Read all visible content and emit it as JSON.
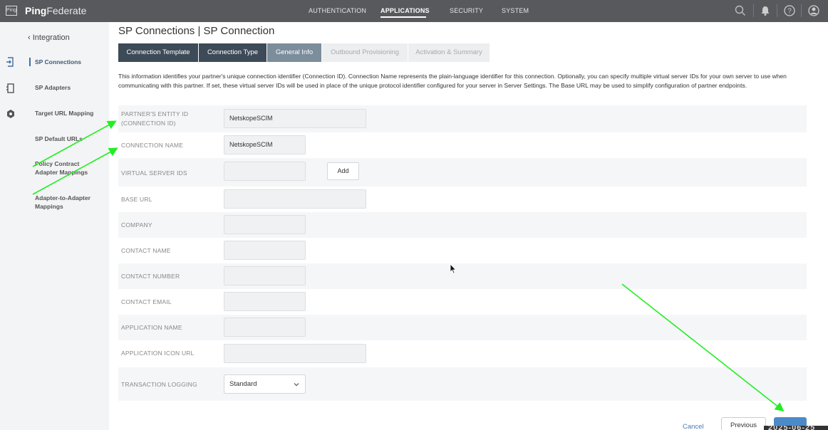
{
  "header": {
    "logo_text": "Ping",
    "brand_bold": "Ping",
    "brand_rest": "Federate",
    "nav": [
      "AUTHENTICATION",
      "APPLICATIONS",
      "SECURITY",
      "SYSTEM"
    ],
    "active_nav": "APPLICATIONS",
    "icons": [
      "search-icon",
      "bell-icon",
      "help-icon",
      "user-icon"
    ]
  },
  "rail": {
    "icons": [
      "connections-icon",
      "adapters-icon",
      "mapping-icon"
    ]
  },
  "sidebar": {
    "back_label": "Integration",
    "items": [
      {
        "label": "SP Connections",
        "active": true
      },
      {
        "label": "SP Adapters"
      },
      {
        "label": "Target URL Mapping"
      },
      {
        "label": "SP Default URLs"
      },
      {
        "label": "Policy Contract Adapter Mappings"
      },
      {
        "label": "Adapter-to-Adapter Mappings"
      }
    ]
  },
  "main": {
    "title": "SP Connections | SP Connection",
    "tabs": [
      {
        "label": "Connection Template",
        "state": "done"
      },
      {
        "label": "Connection Type",
        "state": "done"
      },
      {
        "label": "General Info",
        "state": "current"
      },
      {
        "label": "Outbound Provisioning",
        "state": "future"
      },
      {
        "label": "Activation & Summary",
        "state": "future"
      }
    ],
    "intro": "This information identifies your partner's unique connection identifier (Connection ID). Connection Name represents the plain-language identifier for this connection. Optionally, you can specify multiple virtual server IDs for your own server to use when communicating with this partner. If set, these virtual server IDs will be used in place of the unique protocol identifier configured for your server in Server Settings. The Base URL may be used to simplify configuration of partner endpoints.",
    "fields": {
      "entity_id": {
        "label_line1": "PARTNER'S ENTITY ID",
        "label_line2": "(CONNECTION ID)",
        "value": "NetskopeSCIM"
      },
      "connection_name": {
        "label": "CONNECTION NAME",
        "value": "NetskopeSCIM"
      },
      "virtual_server_ids": {
        "label": "VIRTUAL SERVER IDS",
        "value": "",
        "add_label": "Add"
      },
      "base_url": {
        "label": "BASE URL",
        "value": ""
      },
      "company": {
        "label": "COMPANY",
        "value": ""
      },
      "contact_name": {
        "label": "CONTACT NAME",
        "value": ""
      },
      "contact_number": {
        "label": "CONTACT NUMBER",
        "value": ""
      },
      "contact_email": {
        "label": "CONTACT EMAIL",
        "value": ""
      },
      "application_name": {
        "label": "APPLICATION NAME",
        "value": ""
      },
      "application_icon_url": {
        "label": "APPLICATION ICON URL",
        "value": ""
      },
      "transaction_logging": {
        "label": "TRANSACTION LOGGING",
        "value": "Standard"
      }
    },
    "footer": {
      "cancel_label": "Cancel",
      "previous_label": "Previous"
    },
    "timestamp": "2025-06-25"
  },
  "colors": {
    "topbar": "#58595c",
    "tab_done": "#3d4a57",
    "tab_current": "#7c8d9c",
    "primary_button": "#4b8ac9",
    "annotation_arrow": "#22ee22"
  }
}
